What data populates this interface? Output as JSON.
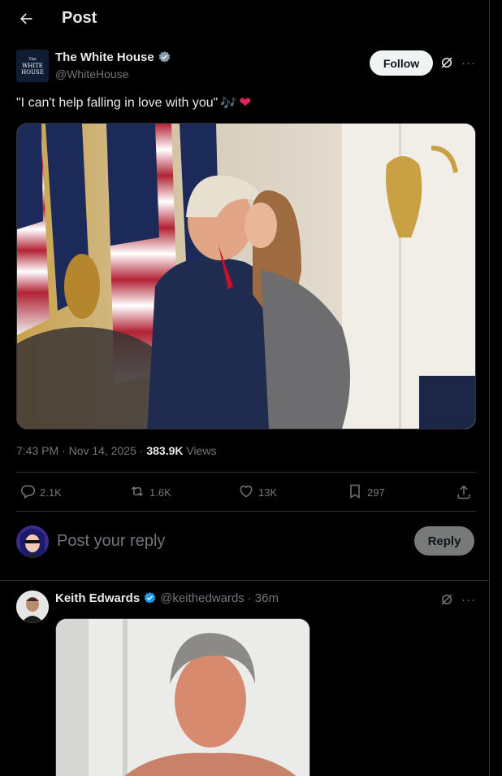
{
  "header": {
    "title": "Post"
  },
  "post": {
    "author_name": "The White House",
    "author_handle": "@WhiteHouse",
    "avatar_line1": "The",
    "avatar_line2": "WHITE",
    "avatar_line3": "HOUSE",
    "follow_label": "Follow",
    "text": "\"I can't help falling in love with you\"",
    "emoji_note": "🎶",
    "emoji_heart": "❤",
    "time": "7:43 PM",
    "date": "Nov 14, 2025",
    "views_count": "383.9K",
    "views_label": "Views",
    "sep": "·",
    "replies": "2.1K",
    "reposts": "1.6K",
    "likes": "13K",
    "bookmarks": "297"
  },
  "composer": {
    "placeholder": "Post your reply",
    "reply_label": "Reply"
  },
  "reply": {
    "author_name": "Keith Edwards",
    "author_handle": "@keithedwards",
    "time": "36m",
    "sep": "·"
  },
  "colors": {
    "verified": "#1d9bf0",
    "background": "#000000",
    "text": "#e7e9ea",
    "muted": "#71767b",
    "border": "#2f3336"
  },
  "icons": [
    "back-arrow-icon",
    "verified-badge-icon",
    "grok-icon",
    "more-icon",
    "reply-icon",
    "repost-icon",
    "like-icon",
    "bookmark-icon",
    "share-icon"
  ]
}
